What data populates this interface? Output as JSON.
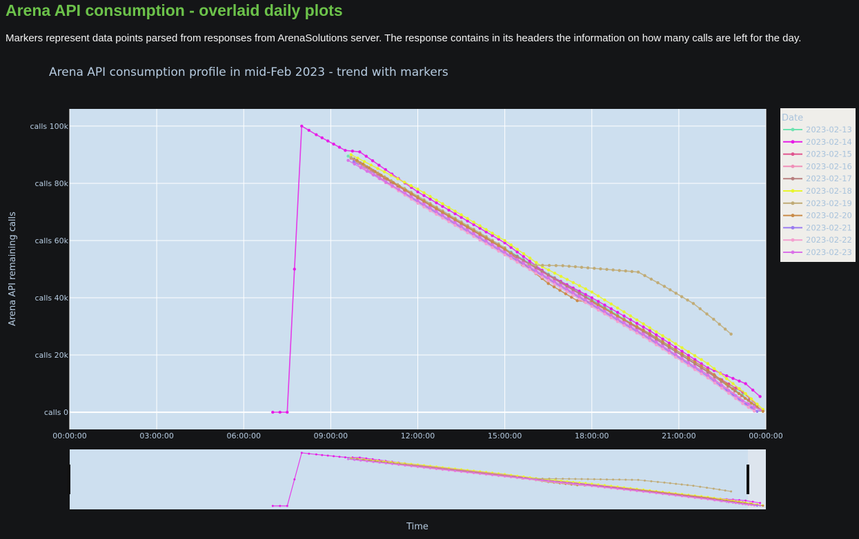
{
  "page": {
    "title": "Arena API consumption - overlaid daily plots",
    "description": "Markers represent data points parsed from responses from ArenaSolutions server. The response contains in its headers the information on how many calls are left for the day."
  },
  "chart_data": {
    "type": "line",
    "title": "Arena API consumption profile in mid-Feb 2023 - trend with markers",
    "xlabel": "Time",
    "ylabel": "Arena API remaining calls",
    "x_unit": "hours since 00:00:00",
    "xlim": [
      0,
      24
    ],
    "ylim": [
      -6000,
      106000
    ],
    "x_ticks": [
      {
        "value": 0,
        "label": "00:00:00"
      },
      {
        "value": 3,
        "label": "03:00:00"
      },
      {
        "value": 6,
        "label": "06:00:00"
      },
      {
        "value": 9,
        "label": "09:00:00"
      },
      {
        "value": 12,
        "label": "12:00:00"
      },
      {
        "value": 15,
        "label": "15:00:00"
      },
      {
        "value": 18,
        "label": "18:00:00"
      },
      {
        "value": 21,
        "label": "21:00:00"
      },
      {
        "value": 24,
        "label": "00:00:00"
      }
    ],
    "y_ticks": [
      {
        "value": 0,
        "label": "calls 0"
      },
      {
        "value": 20000,
        "label": "calls 20k"
      },
      {
        "value": 40000,
        "label": "calls 40k"
      },
      {
        "value": 60000,
        "label": "calls 60k"
      },
      {
        "value": 80000,
        "label": "calls 80k"
      },
      {
        "value": 100000,
        "label": "calls 100k"
      }
    ],
    "grid": true,
    "legend_title": "Date",
    "legend_position": "right",
    "rangeslider": true,
    "series": [
      {
        "name": "2023-02-13",
        "color": "#6fe3b0",
        "points": [
          [
            9.6,
            89500
          ],
          [
            12,
            75200
          ],
          [
            15,
            57200
          ],
          [
            18,
            39400
          ],
          [
            20,
            27200
          ],
          [
            22,
            14200
          ],
          [
            23.2,
            6000
          ],
          [
            23.8,
            600
          ]
        ]
      },
      {
        "name": "2023-02-14",
        "color": "#e61ee6",
        "points": [
          [
            7,
            0
          ],
          [
            7.5,
            0
          ],
          [
            8,
            100000
          ],
          [
            8.5,
            97000
          ],
          [
            9.5,
            91500
          ],
          [
            10,
            91000
          ],
          [
            12,
            77000
          ],
          [
            15,
            59200
          ],
          [
            16.5,
            48000
          ],
          [
            18,
            40000
          ],
          [
            20,
            28500
          ],
          [
            22,
            15500
          ],
          [
            23.3,
            10000
          ],
          [
            23.8,
            5500
          ]
        ]
      },
      {
        "name": "2023-02-15",
        "color": "#e0558f",
        "points": [
          [
            9.7,
            88800
          ],
          [
            12,
            74800
          ],
          [
            15,
            56800
          ],
          [
            18,
            38800
          ],
          [
            20,
            26800
          ],
          [
            22,
            14200
          ],
          [
            23.2,
            7000
          ],
          [
            23.7,
            2500
          ]
        ]
      },
      {
        "name": "2023-02-16",
        "color": "#f08fb8",
        "points": [
          [
            9.8,
            87800
          ],
          [
            12,
            73600
          ],
          [
            15,
            55600
          ],
          [
            18,
            37600
          ],
          [
            20,
            25600
          ],
          [
            22,
            13200
          ],
          [
            23.1,
            5000
          ],
          [
            23.6,
            1200
          ]
        ]
      },
      {
        "name": "2023-02-17",
        "color": "#b87f7f",
        "points": [
          [
            9.8,
            88500
          ],
          [
            12,
            75000
          ],
          [
            15,
            57000
          ],
          [
            18,
            39000
          ],
          [
            20,
            27000
          ],
          [
            22,
            14000
          ],
          [
            23.4,
            4200
          ],
          [
            23.9,
            500
          ]
        ]
      },
      {
        "name": "2023-02-18",
        "color": "#e8f52c",
        "points": [
          [
            9.7,
            90000
          ],
          [
            12,
            78000
          ],
          [
            15,
            60000
          ],
          [
            16.3,
            50800
          ],
          [
            18,
            42000
          ],
          [
            20,
            29500
          ],
          [
            22,
            17000
          ],
          [
            23.3,
            6500
          ],
          [
            23.9,
            1000
          ]
        ]
      },
      {
        "name": "2023-02-19",
        "color": "#c0ab76",
        "points": [
          [
            9.7,
            89000
          ],
          [
            12,
            75500
          ],
          [
            15,
            57500
          ],
          [
            15.6,
            51500
          ],
          [
            17,
            51200
          ],
          [
            19.6,
            49000
          ],
          [
            20.5,
            44000
          ],
          [
            21.5,
            38000
          ],
          [
            22.2,
            32500
          ],
          [
            22.8,
            27300
          ]
        ]
      },
      {
        "name": "2023-02-20",
        "color": "#c98c4a",
        "points": [
          [
            9.9,
            88000
          ],
          [
            12,
            75000
          ],
          [
            15,
            57000
          ],
          [
            16.5,
            45000
          ],
          [
            17.5,
            39000
          ],
          [
            18,
            38500
          ],
          [
            20,
            27500
          ],
          [
            22,
            14800
          ],
          [
            23.5,
            3200
          ],
          [
            23.9,
            300
          ]
        ]
      },
      {
        "name": "2023-02-21",
        "color": "#9a7cf0",
        "points": [
          [
            9.8,
            87500
          ],
          [
            12,
            73500
          ],
          [
            15,
            55500
          ],
          [
            18,
            37500
          ],
          [
            20,
            25500
          ],
          [
            22,
            12500
          ],
          [
            23.3,
            2800
          ],
          [
            23.7,
            300
          ]
        ]
      },
      {
        "name": "2023-02-22",
        "color": "#f4a0cf",
        "points": [
          [
            10,
            86000
          ],
          [
            12,
            73000
          ],
          [
            15,
            55000
          ],
          [
            18,
            37000
          ],
          [
            20,
            25000
          ],
          [
            22,
            12000
          ],
          [
            23.2,
            3000
          ],
          [
            23.6,
            400
          ]
        ]
      },
      {
        "name": "2023-02-23",
        "color": "#da71e8",
        "points": [
          [
            9.6,
            88000
          ],
          [
            12,
            74000
          ],
          [
            15,
            56000
          ],
          [
            18,
            38000
          ],
          [
            20,
            26000
          ],
          [
            22,
            13000
          ],
          [
            23.2,
            4000
          ],
          [
            23.8,
            800
          ]
        ]
      }
    ]
  }
}
